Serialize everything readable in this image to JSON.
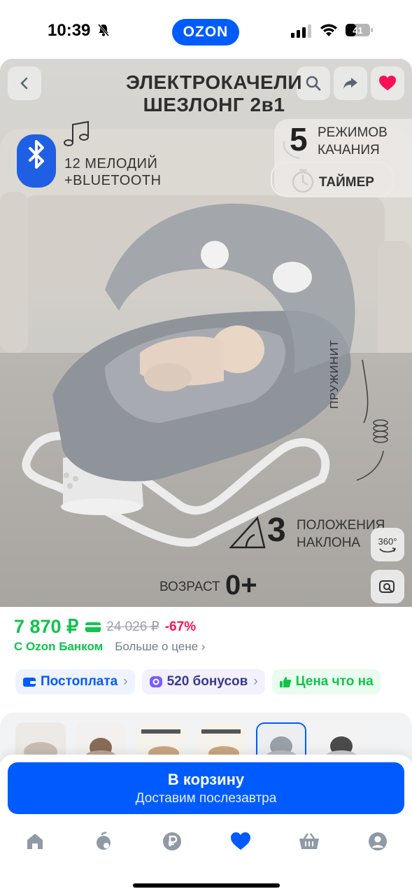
{
  "status_bar": {
    "time": "10:39",
    "brand_badge": "OZON",
    "battery": "41",
    "icons": [
      "bell-muted-icon",
      "signal-icon",
      "wifi-icon",
      "battery-icon"
    ]
  },
  "hero": {
    "title_line1": "ЭЛЕКТРОКАЧЕЛИ",
    "title_line2": "ШЕЗЛОНГ 2в1",
    "melodies_line1": "12 МЕЛОДИЙ",
    "melodies_line2": "+BLUETOOTH",
    "modes_number": "5",
    "modes_line1": "РЕЖИМОВ",
    "modes_line2": "КАЧАНИЯ",
    "timer": "ТАЙМЕР",
    "spring": "ПРУЖИНИТ",
    "tilt_number": "3",
    "tilt_line1": "ПОЛОЖЕНИЯ",
    "tilt_line2": "НАКЛОНА",
    "age_label": "ВОЗРАСТ",
    "age_value": "0+",
    "view_360": "360°",
    "buttons": [
      "back-icon",
      "search-icon",
      "share-icon",
      "heart-icon"
    ],
    "favorite_color": "#f91155"
  },
  "price": {
    "current": "7 870 ₽",
    "old": "24 026 ₽",
    "discount": "-67%",
    "bank_label": "С Ozon Банком",
    "more_link": "Больше о цене",
    "colors": {
      "current": "#10c44c",
      "discount": "#f91155"
    }
  },
  "chips": [
    {
      "label": "Постоплата",
      "icon": "wallet-icon"
    },
    {
      "label": "520 бонусов",
      "icon": "bonus-icon"
    },
    {
      "label": "Цена что на",
      "icon": "thumbs-up-icon"
    }
  ],
  "thumbnails": {
    "count": 6,
    "selected_index": 4
  },
  "cart": {
    "label": "В корзину",
    "subtitle": "Доставим послезавтра",
    "color": "#005bff"
  },
  "tabbar": {
    "items": [
      "home-icon",
      "catalog-icon",
      "ruble-icon",
      "favorites-icon",
      "cart-icon",
      "profile-icon"
    ],
    "active": "favorites-icon"
  }
}
